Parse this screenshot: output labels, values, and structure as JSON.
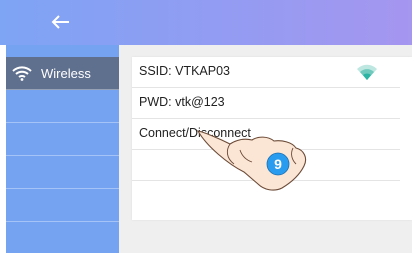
{
  "header": {
    "back_icon": "arrow-left-icon"
  },
  "sidebar": {
    "items": [
      {
        "label": "Wireless",
        "icon": "wifi-icon",
        "active": true
      },
      {
        "label": ""
      },
      {
        "label": ""
      },
      {
        "label": ""
      },
      {
        "label": ""
      },
      {
        "label": ""
      }
    ]
  },
  "wifi": {
    "ssid_label": "SSID: VTKAP03",
    "pwd_label": "PWD: vtk@123",
    "action_label": "Connect/Disconnect",
    "signal_icon": "wifi-signal-icon"
  },
  "annotation": {
    "step_number": "9",
    "icon": "pointing-hand-icon"
  },
  "colors": {
    "header_gradient_start": "#7ea4f4",
    "header_gradient_end": "#a596f0",
    "sidebar_bg": "#76a3f1",
    "sidebar_active_bg": "#5f6f8e",
    "wifi_signal": "#2bb3a3",
    "step_badge": "#2a9cf0"
  }
}
